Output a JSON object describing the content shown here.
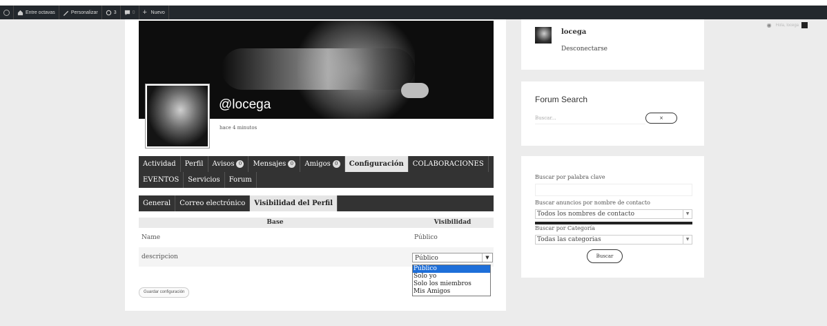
{
  "adminbar": {
    "site": "Entre octavas",
    "customize": "Personalizar",
    "updates": "3",
    "comments": "0",
    "new": "Nuevo"
  },
  "profile": {
    "username": "@locega",
    "last_activity": "hace 4 minutos"
  },
  "nav": {
    "row1": [
      {
        "label": "Actividad"
      },
      {
        "label": "Perfil"
      },
      {
        "label": "Avisos",
        "badge": "0"
      },
      {
        "label": "Mensajes",
        "badge": "0"
      },
      {
        "label": "Amigos",
        "badge": "0"
      },
      {
        "label": "Configuración",
        "active": true
      },
      {
        "label": "COLABORACIONES"
      }
    ],
    "row2": [
      {
        "label": "EVENTOS"
      },
      {
        "label": "Servicios"
      },
      {
        "label": "Forum"
      }
    ]
  },
  "subnav": [
    {
      "label": "General"
    },
    {
      "label": "Correo electrónico"
    },
    {
      "label": "Visibilidad del Perfil",
      "active": true
    }
  ],
  "table": {
    "col_base": "Base",
    "col_visibility": "Visibilidad",
    "rows": [
      {
        "field": "Name",
        "visibility": "Público"
      },
      {
        "field": "descripcion",
        "visibility": "Público"
      }
    ]
  },
  "dropdown": {
    "options": [
      "Público",
      "Solo yo",
      "Solo los miembros",
      "Mis Amigos"
    ],
    "selected_index": 0
  },
  "save_button": "Guardar configuración",
  "sidebar": {
    "user": {
      "name": "locega",
      "logout": "Desconectarse"
    },
    "forum_search": {
      "title": "Forum Search",
      "placeholder": "Buscar...",
      "button": "×"
    },
    "classifieds": {
      "keyword_label": "Buscar por palabra clave",
      "contact_label": "Buscar anuncios por nombre de contacto",
      "contact_value": "Todos los nombres de contacto",
      "category_label": "Buscar por Categoría",
      "category_value": "Todas las categorias",
      "button": "Buscar"
    }
  },
  "corner": {
    "text": "Hola, locega"
  }
}
